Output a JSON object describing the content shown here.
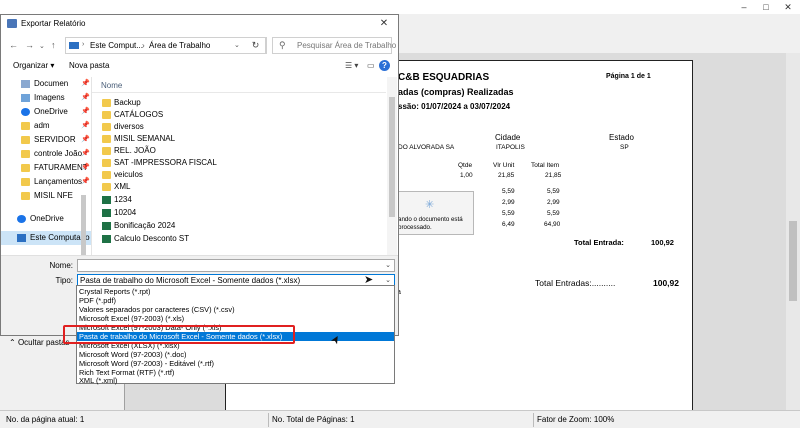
{
  "background_window": {
    "report": {
      "company": "C&B ESQUADRIAS",
      "page_indicator": "Página 1 de 1",
      "subtitle": "adas (compras) Realizadas",
      "period": "ssão: 01/07/2024 a 03/07/2024",
      "col_cidade": "Cidade",
      "col_estado": "Estado",
      "supplier": "DO ALVORADA SA",
      "city": "ITAPOLIS",
      "state": "SP",
      "col_qtde": "Qtde",
      "col_vlr_unit": "Vlr Unit",
      "col_total_item": "Total Item",
      "rows": [
        {
          "qtde": "1,00",
          "vlr_unit": "21,85",
          "total": "21,85"
        },
        {
          "qtde": "",
          "vlr_unit": "5,59",
          "total": "5,59"
        },
        {
          "qtde": "",
          "vlr_unit": "2,99",
          "total": "2,99"
        },
        {
          "qtde": "",
          "vlr_unit": "5,59",
          "total": "5,59"
        },
        {
          "qtde": "",
          "vlr_unit": "6,49",
          "total": "64,90"
        }
      ],
      "tooltip_line1": "ando o documento está",
      "tooltip_line2": "processado.",
      "total_entrada_label": "Total Entrada:",
      "total_entrada_value": "100,92",
      "total_entradas_label": "Total Entradas:..........",
      "total_entradas_value": "100,92",
      "fragment_a": "a"
    },
    "status": {
      "page_current": "No. da página atual: 1",
      "page_total": "No. Total de Páginas: 1",
      "zoom": "Fator de Zoom: 100%"
    }
  },
  "dialog": {
    "title": "Exportar Relatório",
    "address": {
      "root": "Este Comput...",
      "separator": "›",
      "folder": "Área de Trabalho"
    },
    "search_placeholder": "Pesquisar Área de Trabalho",
    "toolbar": {
      "organize": "Organizar ▾",
      "new_folder": "Nova pasta"
    },
    "nav_items": [
      {
        "label": "Documen",
        "icon": "documents-icon",
        "pinned": true
      },
      {
        "label": "Imagens",
        "icon": "pictures-icon",
        "pinned": true
      },
      {
        "label": "OneDrive",
        "icon": "onedrive-icon",
        "pinned": true
      },
      {
        "label": "adm",
        "icon": "folder-icon",
        "pinned": true
      },
      {
        "label": "SERVIDOR",
        "icon": "folder-icon",
        "pinned": true
      },
      {
        "label": "controle João",
        "icon": "folder-icon",
        "pinned": true
      },
      {
        "label": "FATURAMENT",
        "icon": "folder-icon",
        "pinned": true
      },
      {
        "label": "Lançamentos",
        "icon": "folder-icon",
        "pinned": true
      },
      {
        "label": "MISIL NFE",
        "icon": "folder-icon",
        "pinned": false
      },
      {
        "label": "OneDrive",
        "icon": "onedrive-icon",
        "pinned": false
      },
      {
        "label": "Este Computado",
        "icon": "computer-icon",
        "pinned": false
      }
    ],
    "column_name": "Nome",
    "files": [
      {
        "name": "Backup",
        "type": "folder"
      },
      {
        "name": "CATÁLOGOS",
        "type": "folder"
      },
      {
        "name": "diversos",
        "type": "folder"
      },
      {
        "name": "MISIL SEMANAL",
        "type": "folder"
      },
      {
        "name": "REL. JOÃO",
        "type": "folder"
      },
      {
        "name": "SAT -IMPRESSORA FISCAL",
        "type": "folder"
      },
      {
        "name": "veiculos",
        "type": "folder"
      },
      {
        "name": "XML",
        "type": "folder"
      },
      {
        "name": "1234",
        "type": "xls"
      },
      {
        "name": "10204",
        "type": "xls"
      },
      {
        "name": "Bonificação 2024",
        "type": "xls"
      },
      {
        "name": "Calculo Desconto ST",
        "type": "xls"
      }
    ],
    "name_label": "Nome:",
    "name_value": "",
    "type_label": "Tipo:",
    "type_value": "Pasta de trabalho do Microsoft Excel - Somente dados (*.xlsx)",
    "hide_folders": "Ocultar pastas",
    "type_options": [
      "Crystal Reports (*.rpt)",
      "PDF (*.pdf)",
      "Valores separados por caracteres (CSV) (*.csv)",
      "Microsoft Excel (97-2003) (*.xls)",
      "Microsoft Excel (97-2003) Data- Only (*.xls)",
      "Pasta de trabalho do Microsoft Excel - Somente dados (*.xlsx)",
      "Microsoft Excel (XLSX) (*.xlsx)",
      "Microsoft Word (97-2003) (*.doc)",
      "Microsoft Word (97-2003) - Editável (*.rtf)",
      "Rich Text Format (RTF) (*.rtf)",
      "XML (*.xml)"
    ],
    "selected_option_index": 5,
    "colors": {
      "accent": "#0078d7",
      "highlight": "#e02020"
    }
  }
}
